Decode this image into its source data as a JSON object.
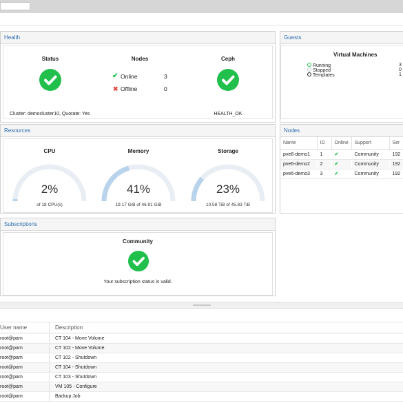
{
  "colors": {
    "accent": "#2f6fb0",
    "ok_green": "#21bf4b",
    "error_red": "#e0443a",
    "gauge_track": "#e9eef4",
    "gauge_fill": "#b9d3ec"
  },
  "health": {
    "title": "Health",
    "status": {
      "title": "Status",
      "cluster_text": "Cluster: democluster10, Quorate: Yes",
      "icon": "check-circle-icon"
    },
    "nodes": {
      "title": "Nodes",
      "online_label": "Online",
      "online_count": "3",
      "offline_label": "Offline",
      "offline_count": "0"
    },
    "ceph": {
      "title": "Ceph",
      "status_text": "HEALTH_OK",
      "icon": "check-circle-icon"
    }
  },
  "guests": {
    "title": "Guests",
    "vm_title": "Virtual Machines",
    "items": [
      {
        "label": "Running",
        "count": "3"
      },
      {
        "label": "Stopped",
        "count": "0"
      },
      {
        "label": "Templates",
        "count": "1"
      }
    ]
  },
  "resources": {
    "title": "Resources",
    "cpu": {
      "title": "CPU",
      "value": "2%",
      "fraction": 0.02,
      "sub": "of 18 CPU(s)"
    },
    "memory": {
      "title": "Memory",
      "value": "41%",
      "fraction": 0.41,
      "sub": "19.17 GiB of 46.91 GiB"
    },
    "storage": {
      "title": "Storage",
      "value": "23%",
      "fraction": 0.23,
      "sub": "10.58 TiB of 45.83 TiB"
    }
  },
  "nodes_panel": {
    "title": "Nodes",
    "columns": [
      "Name",
      "ID",
      "Online",
      "Support",
      "Ser"
    ],
    "rows": [
      {
        "name": "pve6-demo1",
        "id": "1",
        "online": "✔",
        "support": "Community",
        "server": "192"
      },
      {
        "name": "pve6-demo2",
        "id": "2",
        "online": "✔",
        "support": "Community",
        "server": "192"
      },
      {
        "name": "pve6-demo3",
        "id": "3",
        "online": "✔",
        "support": "Community",
        "server": "192"
      }
    ]
  },
  "subscriptions": {
    "title": "Subscriptions",
    "level": "Community",
    "status_text": "Your subscription status is valid."
  },
  "tasks": {
    "columns": [
      "User name",
      "Description"
    ],
    "rows": [
      {
        "user": "root@pam",
        "desc": "CT 104 - Move Volume"
      },
      {
        "user": "root@pam",
        "desc": "CT 102 - Move Volume"
      },
      {
        "user": "root@pam",
        "desc": "CT 102 - Shutdown"
      },
      {
        "user": "root@pam",
        "desc": "CT 104 - Shutdown"
      },
      {
        "user": "root@pam",
        "desc": "CT 103 - Shutdown"
      },
      {
        "user": "root@pam",
        "desc": "VM 105 - Configure"
      },
      {
        "user": "root@pam",
        "desc": "Backup Job"
      }
    ]
  }
}
